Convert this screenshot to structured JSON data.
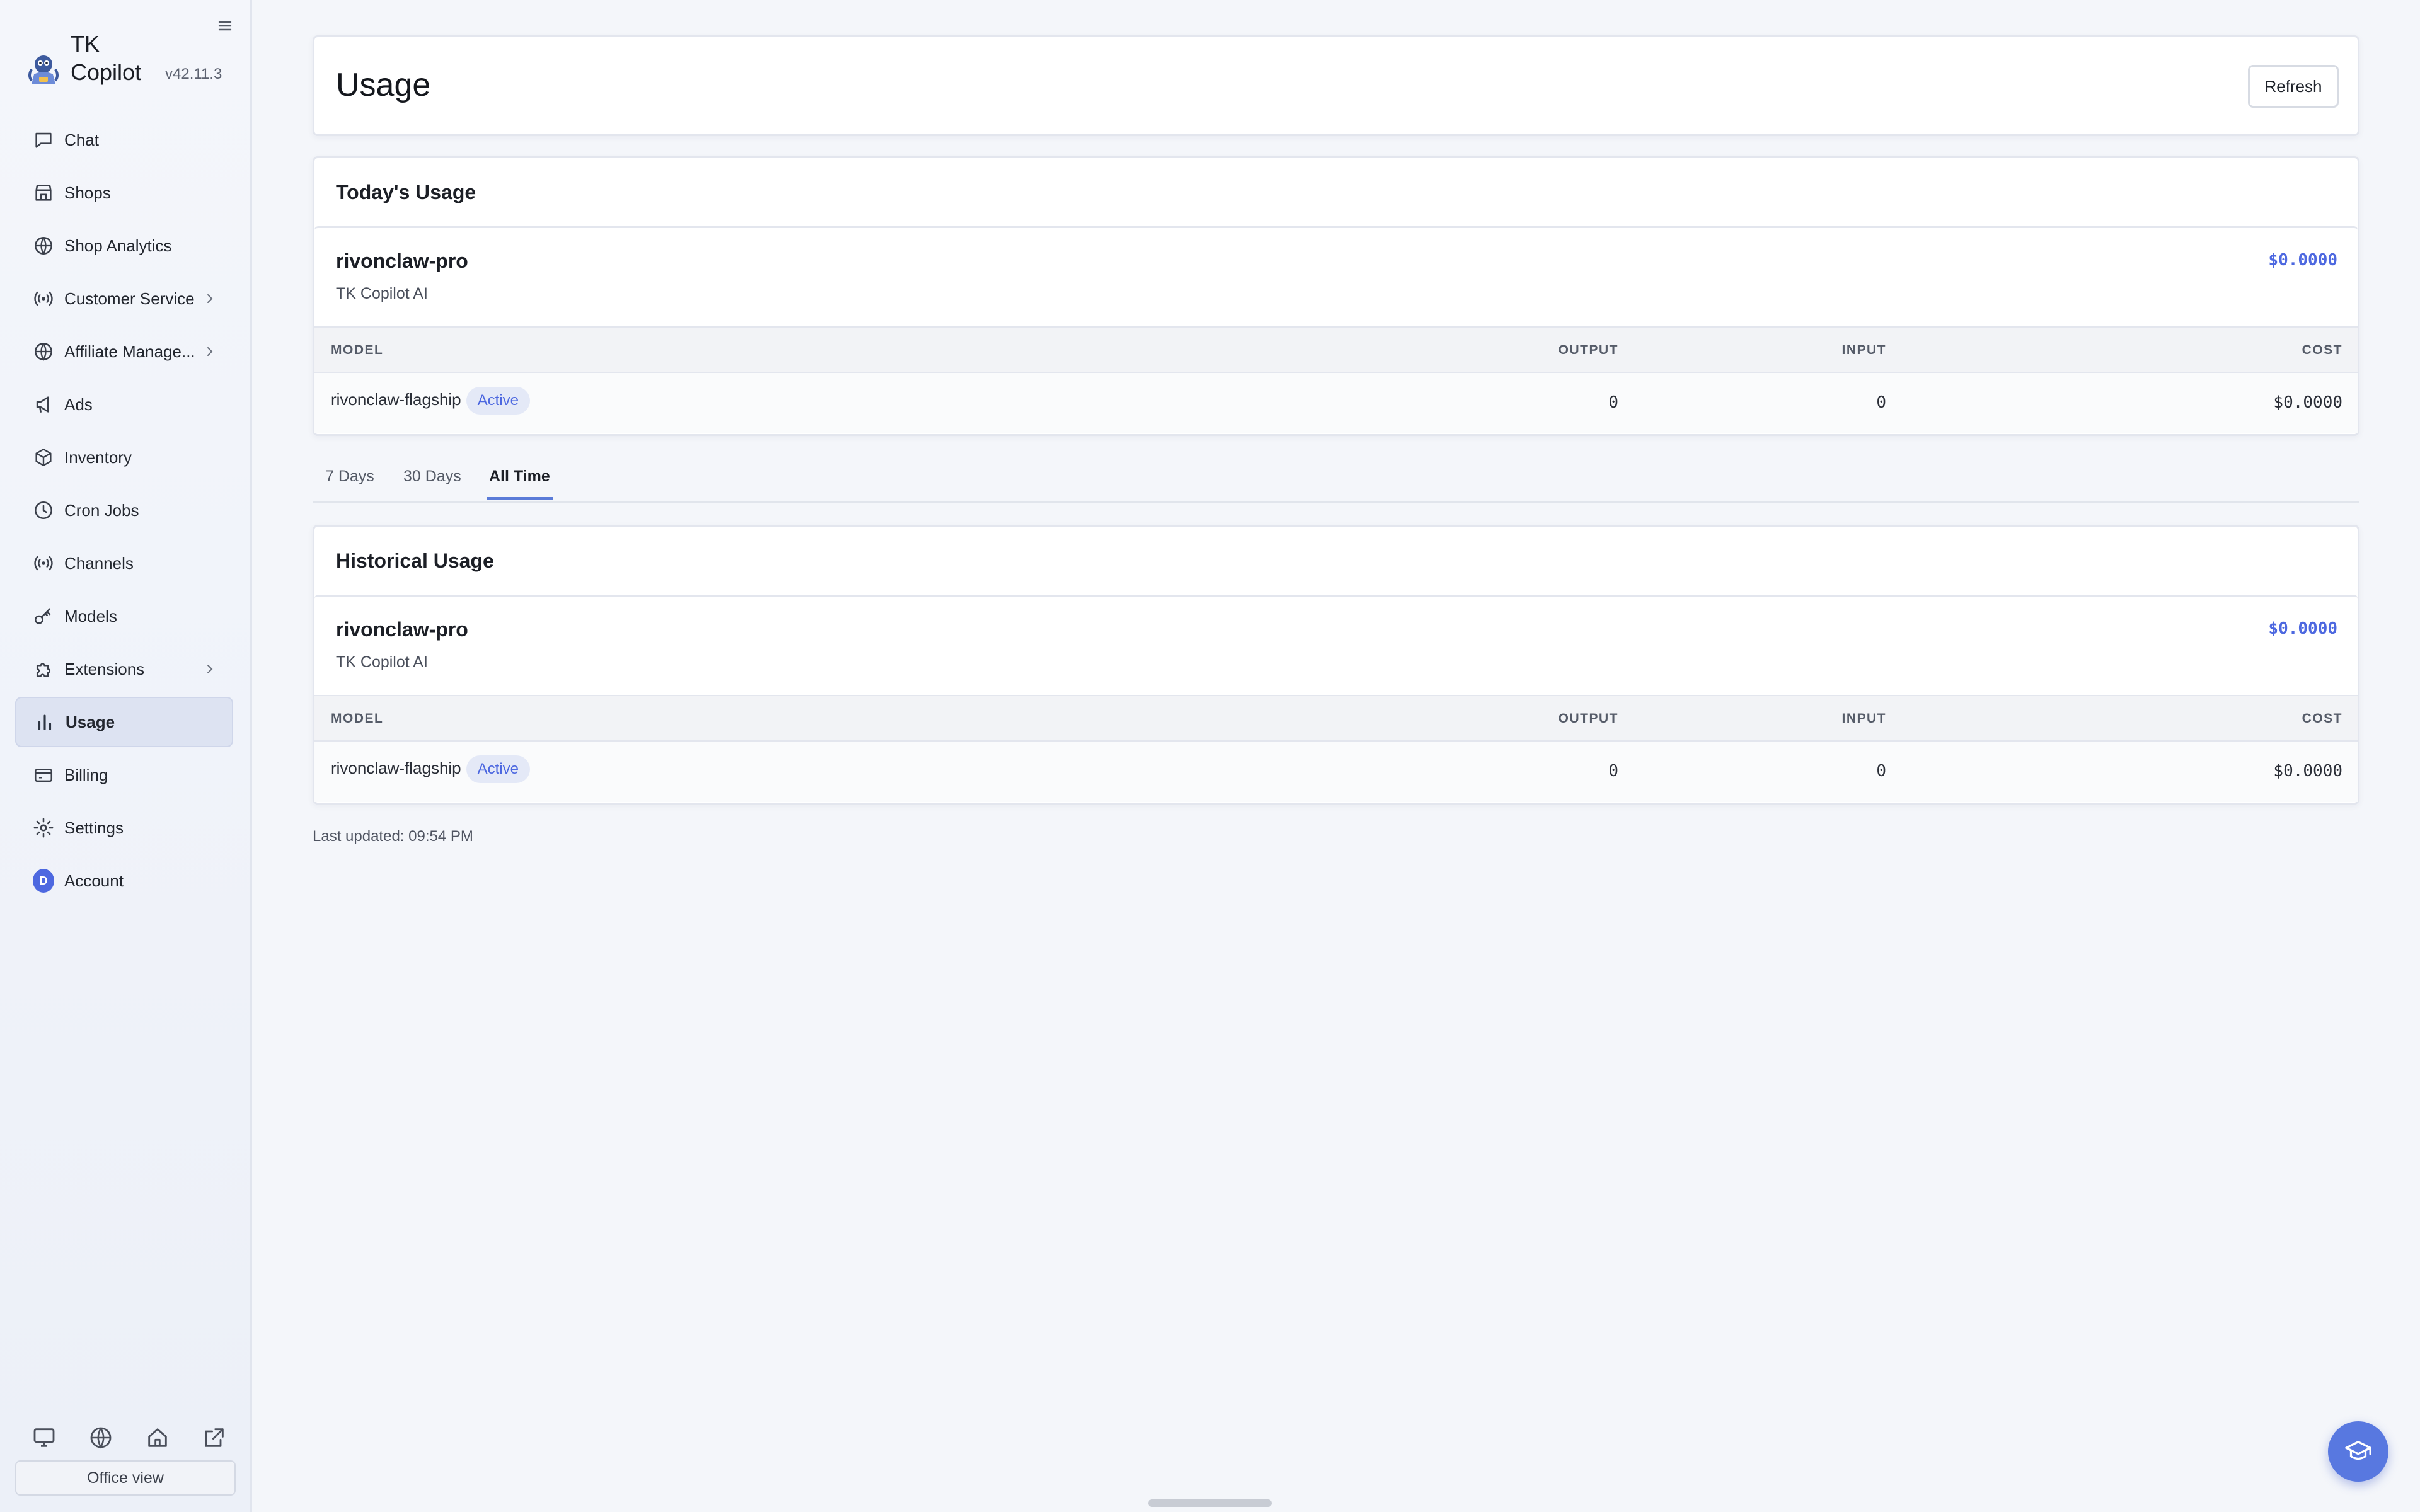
{
  "app": {
    "name": "TK Copilot",
    "version": "v42.11.3"
  },
  "sidebar": {
    "items": [
      {
        "label": "Chat",
        "icon": "chat-icon"
      },
      {
        "label": "Shops",
        "icon": "shop-icon"
      },
      {
        "label": "Shop Analytics",
        "icon": "globe-icon"
      },
      {
        "label": "Customer Service",
        "icon": "broadcast-icon",
        "expandable": true
      },
      {
        "label": "Affiliate Manage...",
        "icon": "globe-icon",
        "expandable": true
      },
      {
        "label": "Ads",
        "icon": "megaphone-icon"
      },
      {
        "label": "Inventory",
        "icon": "box-icon"
      },
      {
        "label": "Cron Jobs",
        "icon": "clock-icon"
      },
      {
        "label": "Channels",
        "icon": "broadcast-icon"
      },
      {
        "label": "Models",
        "icon": "key-icon"
      },
      {
        "label": "Extensions",
        "icon": "puzzle-icon",
        "expandable": true
      },
      {
        "label": "Usage",
        "icon": "bar-chart-icon",
        "active": true
      },
      {
        "label": "Billing",
        "icon": "billing-icon"
      },
      {
        "label": "Settings",
        "icon": "gear-icon"
      },
      {
        "label": "Account",
        "icon": "avatar",
        "avatar_initial": "D"
      }
    ],
    "footer_icons": [
      "monitor-icon",
      "globe-icon",
      "home-icon",
      "external-link-icon"
    ],
    "office_view_label": "Office view"
  },
  "header": {
    "title": "Usage",
    "refresh_label": "Refresh"
  },
  "today": {
    "title": "Today's Usage",
    "provider": {
      "name": "rivonclaw-pro",
      "subtitle": "TK Copilot AI",
      "total_cost": "$0.0000"
    },
    "columns": {
      "model": "MODEL",
      "input": "INPUT",
      "output": "OUTPUT",
      "cost": "COST"
    },
    "row": {
      "model": "rivonclaw-flagship",
      "status": "Active",
      "input": "0",
      "output": "0",
      "cost": "$0.0000"
    }
  },
  "tabs": [
    {
      "label": "7 Days",
      "active": false
    },
    {
      "label": "30 Days",
      "active": false
    },
    {
      "label": "All Time",
      "active": true
    }
  ],
  "historical": {
    "title": "Historical Usage",
    "provider": {
      "name": "rivonclaw-pro",
      "subtitle": "TK Copilot AI",
      "total_cost": "$0.0000"
    },
    "columns": {
      "model": "MODEL",
      "input": "INPUT",
      "output": "OUTPUT",
      "cost": "COST"
    },
    "row": {
      "model": "rivonclaw-flagship",
      "status": "Active",
      "input": "0",
      "output": "0",
      "cost": "$0.0000"
    }
  },
  "last_updated": "Last updated: 09:54 PM",
  "colors": {
    "accent": "#4d68e0",
    "tab_underline": "#5a7bd8"
  }
}
